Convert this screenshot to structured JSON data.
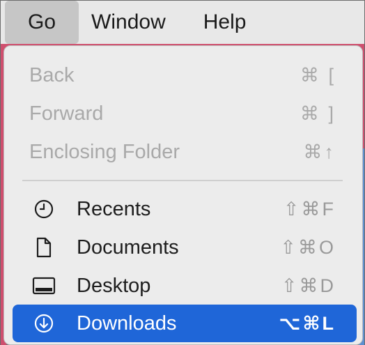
{
  "menubar": {
    "items": [
      {
        "label": "Go"
      },
      {
        "label": "Window"
      },
      {
        "label": "Help"
      }
    ]
  },
  "go_menu": {
    "disabled_items": [
      {
        "label": "Back",
        "shortcut": "⌘ ["
      },
      {
        "label": "Forward",
        "shortcut": "⌘ ]"
      },
      {
        "label": "Enclosing Folder",
        "shortcut": "⌘↑"
      }
    ],
    "items": [
      {
        "label": "Recents",
        "shortcut": "⇧⌘F",
        "icon": "clock-icon"
      },
      {
        "label": "Documents",
        "shortcut": "⇧⌘O",
        "icon": "document-icon"
      },
      {
        "label": "Desktop",
        "shortcut": "⇧⌘D",
        "icon": "desktop-icon"
      },
      {
        "label": "Downloads",
        "shortcut": "⌥⌘L",
        "icon": "download-icon",
        "highlighted": true
      }
    ]
  },
  "colors": {
    "highlight": "#1f66d8",
    "menu_bg": "#ececec",
    "disabled_text": "#a9a9a9"
  }
}
